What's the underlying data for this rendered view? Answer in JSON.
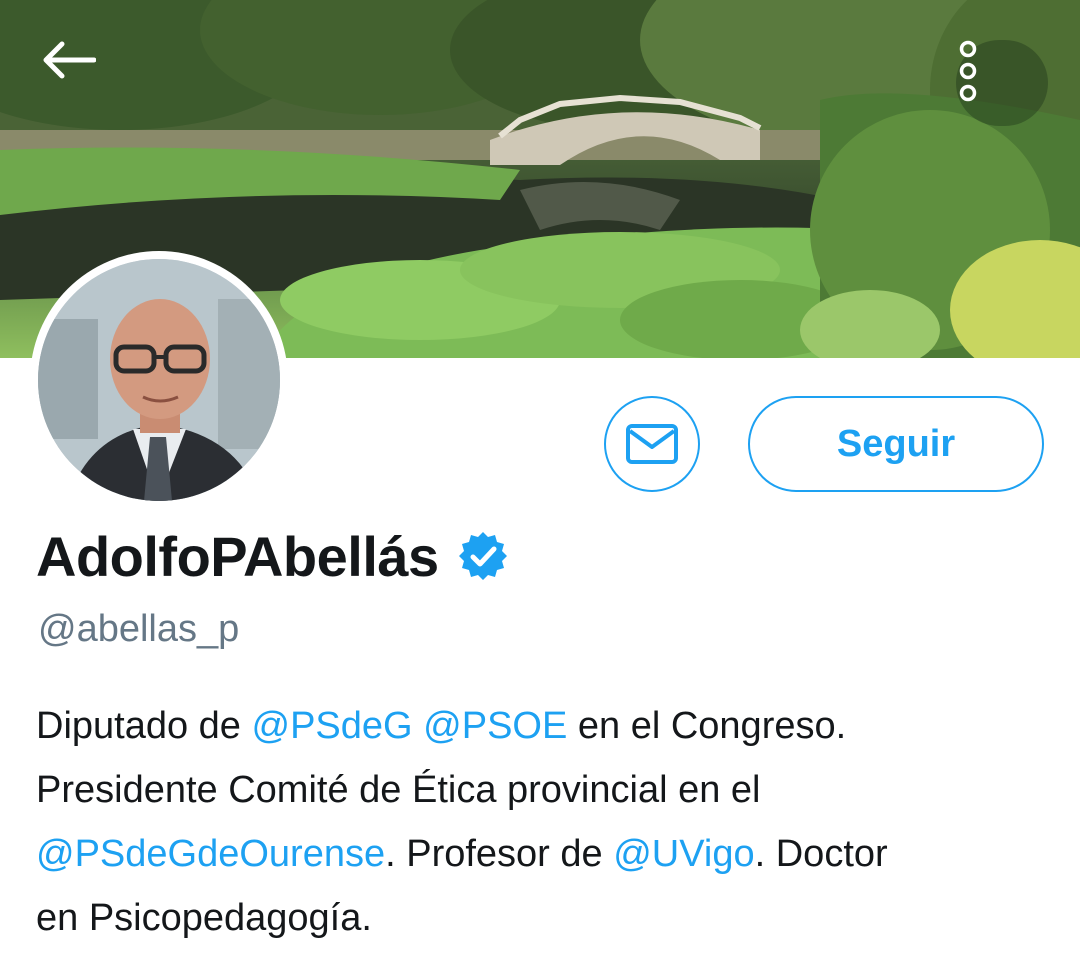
{
  "header": {
    "back_icon": "arrow-left-icon",
    "more_icon": "vertical-ellipsis-icon"
  },
  "actions": {
    "message_icon": "envelope-icon",
    "follow_label": "Seguir",
    "accent_color": "#1da1f2"
  },
  "profile": {
    "display_name": "AdolfoPAbellás",
    "verified_icon": "verified-badge-icon",
    "handle": "@abellas_p",
    "bio": {
      "line1_a": "Diputado de ",
      "mention1": "@PSdeG",
      "line1_b": " ",
      "mention2": "@PSOE",
      "line1_c": " en el Congreso.",
      "line2": "Presidente Comité de Ética provincial en el",
      "mention3": "@PSdeGdeOurense",
      "line3_a": ". Profesor de ",
      "mention4": "@UVigo",
      "line3_b": ". Doctor",
      "line4": "en Psicopedagogía."
    }
  }
}
